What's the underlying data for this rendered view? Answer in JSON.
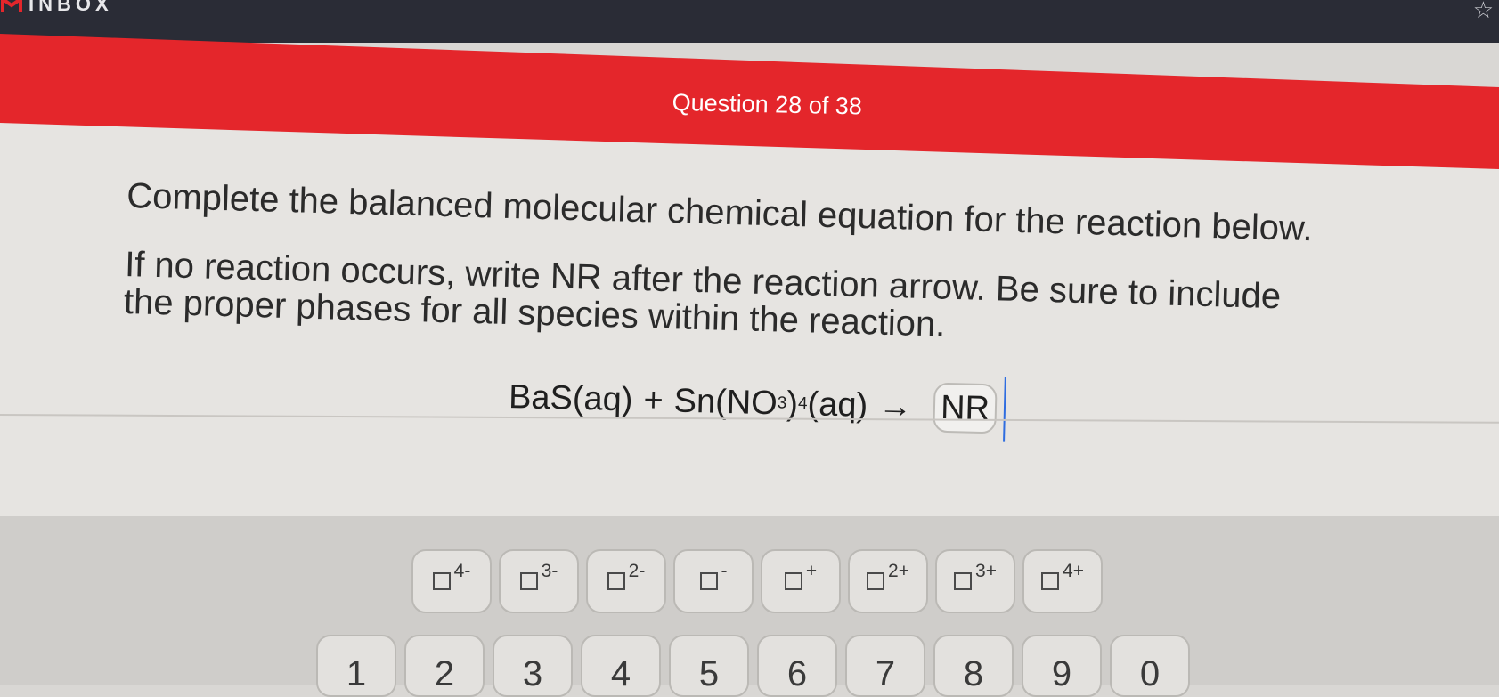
{
  "header": {
    "brand": "INBOX",
    "star_icon": "star-icon"
  },
  "question": {
    "counter": "Question 28 of 38",
    "instruction_1": "Complete the balanced molecular chemical equation for the reaction below.",
    "instruction_2": "If no reaction occurs, write NR after the reaction arrow. Be sure to include the proper phases for all species within the reaction."
  },
  "equation": {
    "reactant1": "BaS(aq)",
    "plus": "+",
    "reactant2_pre": "Sn(NO",
    "sub1": "3",
    "paren_close": ")",
    "sub2": "4",
    "reactant2_post": "(aq)",
    "arrow": "→",
    "answer": "NR"
  },
  "charge_keys": [
    {
      "sup": "4-"
    },
    {
      "sup": "3-"
    },
    {
      "sup": "2-"
    },
    {
      "sup": "-"
    },
    {
      "sup": "+"
    },
    {
      "sup": "2+"
    },
    {
      "sup": "3+"
    },
    {
      "sup": "4+"
    }
  ],
  "number_keys": [
    "1",
    "2",
    "3",
    "4",
    "5",
    "6",
    "7",
    "8",
    "9",
    "0"
  ],
  "colors": {
    "accent_red": "#e4262b",
    "cursor_blue": "#2f6de0"
  }
}
